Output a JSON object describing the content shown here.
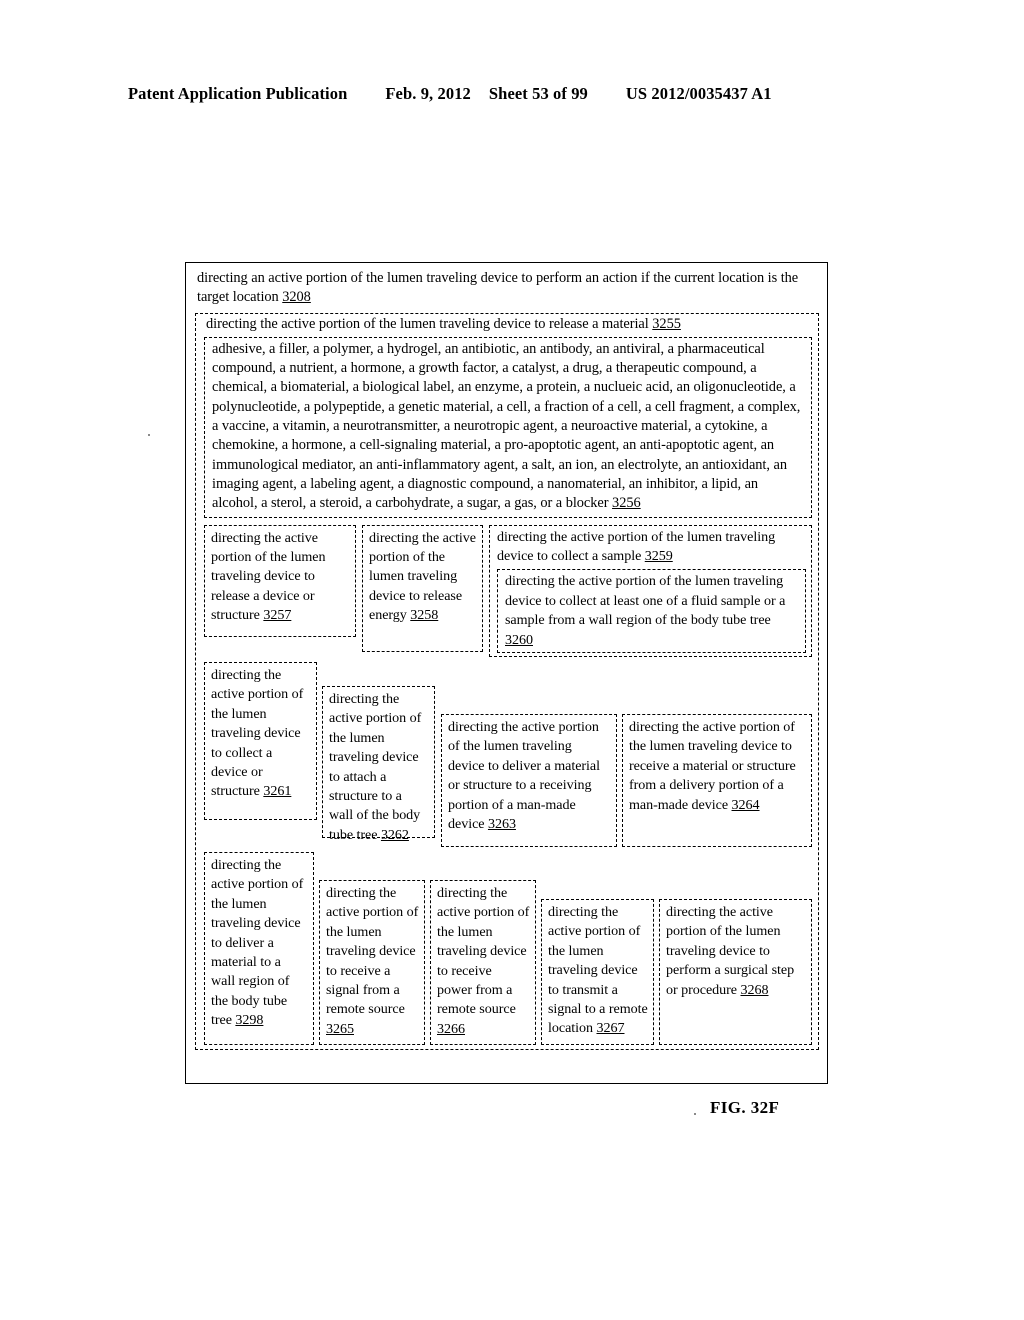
{
  "header": {
    "publication": "Patent Application Publication",
    "date": "Feb. 9, 2012",
    "sheet": "Sheet 53 of 99",
    "number": "US 2012/0035437 A1"
  },
  "figure_label": "FIG. 32F",
  "diagram": {
    "root": {
      "ref": "3208",
      "text": "directing an active portion of the lumen traveling device to perform an action if the current location is the target location 3208"
    },
    "box_3255": {
      "ref": "3255",
      "text": "directing the active portion of the lumen traveling device to release a material 3255"
    },
    "box_3256": {
      "ref": "3256",
      "text": "adhesive, a filler, a polymer, a hydrogel, an antibiotic, an antibody, an antiviral, a pharmaceutical compound, a nutrient, a hormone, a growth factor, a catalyst, a drug, a therapeutic compound, a chemical, a biomaterial, a biological label, an enzyme, a protein, a nuclueic acid, an oligonucleotide, a polynucleotide,  a polypeptide, a genetic material, a cell, a fraction of a cell, a cell fragment, a complex, a vaccine, a vitamin, a neurotransmitter, a neurotropic agent, a neuroactive material, a cytokine, a chemokine, a hormone, a cell-signaling material, a pro-apoptotic agent, an anti-apoptotic agent, an immunological mediator, an anti-inflammatory agent, a salt, an ion, an electrolyte, an antioxidant, an imaging agent, a labeling agent, a diagnostic compound, a nanomaterial, an inhibitor, a lipid, an alcohol, a sterol, a steroid, a carbohydrate, a sugar, a gas, or a blocker 3256"
    },
    "box_3257": {
      "ref": "3257",
      "text": "directing the active portion of the lumen traveling device to release a device or structure 3257"
    },
    "box_3258": {
      "ref": "3258",
      "text": "directing the active portion of the lumen traveling device to release energy 3258"
    },
    "box_3259": {
      "ref": "3259",
      "text": "directing the active portion of the lumen traveling device to collect a sample 3259"
    },
    "box_3260": {
      "ref": "3260",
      "text": "directing the active portion of the lumen traveling device to collect at least one of a fluid sample or a sample from a wall region of the body tube tree 3260"
    },
    "box_3261": {
      "ref": "3261",
      "text": "directing the active portion of the lumen traveling device to collect a device or structure 3261"
    },
    "box_3262": {
      "ref": "3262",
      "text": "directing the active portion of the lumen traveling device to attach a structure to a wall of the body tube tree 3262"
    },
    "box_3263": {
      "ref": "3263",
      "text": "directing the active portion of the lumen traveling device to deliver a material or structure to a receiving portion of a man-made device 3263"
    },
    "box_3264": {
      "ref": "3264",
      "text": "directing the active portion of the lumen traveling device to receive a material or structure from a delivery portion of a man-made device 3264"
    },
    "box_3298": {
      "ref": "3298",
      "text": "directing the active portion of the lumen traveling device to deliver a material to a wall region of the body tube tree 3298"
    },
    "box_3265": {
      "ref": "3265",
      "text": "directing the active portion of the lumen traveling device to receive a signal from a remote source 3265"
    },
    "box_3266": {
      "ref": "3266",
      "text": "directing the active portion of the lumen traveling device to receive power from a remote source 3266"
    },
    "box_3267": {
      "ref": "3267",
      "text": "directing the active portion of the lumen traveling device to transmit a signal to a remote location 3267"
    },
    "box_3268": {
      "ref": "3268",
      "text": "directing the active portion of the lumen traveling device to perform a surgical step or procedure 3268"
    }
  }
}
